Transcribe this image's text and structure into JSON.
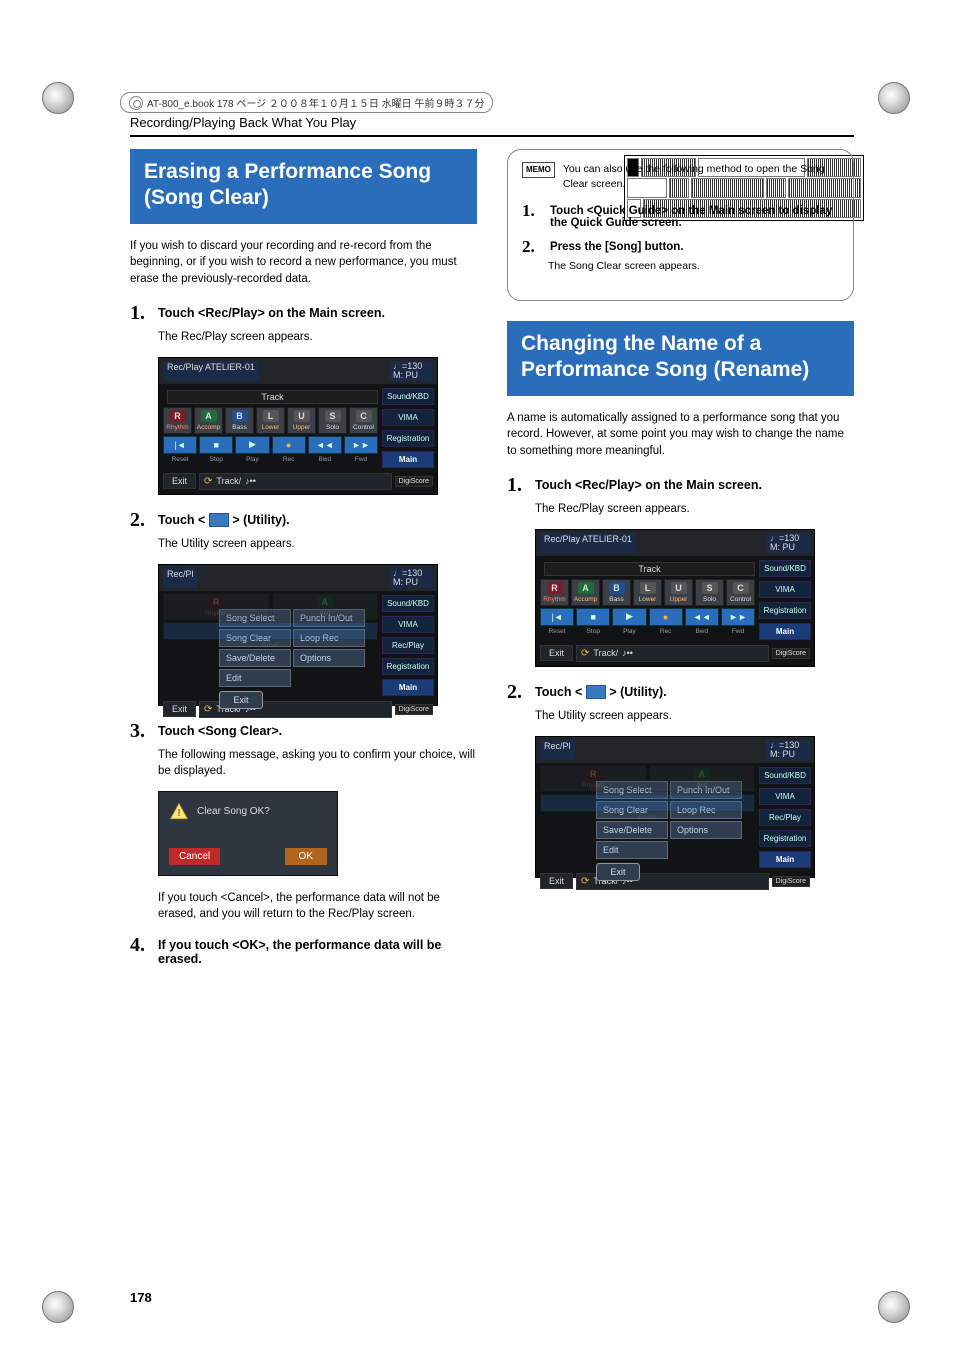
{
  "meta": {
    "header_line": "AT-800_e.book 178 ページ ２００８年１０月１５日 水曜日 午前９時３７分"
  },
  "section_header": "Recording/Playing Back What You Play",
  "left": {
    "heading": "Erasing a Performance Song (Song Clear)",
    "intro": "If you wish to discard your recording and re-record from the beginning, or if you wish to record a new performance, you must erase the previously-recorded data.",
    "step1_title": "Touch <Rec/Play> on the Main screen.",
    "step1_body": "The Rec/Play screen appears.",
    "step2_title_a": "Touch <",
    "step2_title_b": "> (Utility).",
    "step2_body": "The Utility screen appears.",
    "step3_title": "Touch <Song Clear>.",
    "step3_body": "The following message, asking you to confirm your choice, will be displayed.",
    "confirm_text": "Clear Song OK?",
    "cancel": "Cancel",
    "ok": "OK",
    "after_confirm": "If you touch <Cancel>, the performance data will not be erased, and you will return to the Rec/Play screen.",
    "step4_title": "If you touch <OK>, the performance data will be erased."
  },
  "right": {
    "memo_label": "MEMO",
    "memo_text": "You can also use the following method to open the Song Clear screen.",
    "memo_step1": "Touch <Quick Guide> on the Main screen to display the Quick Guide screen.",
    "memo_step2_title": "Press the [Song] button.",
    "memo_step2_body": "The Song Clear screen appears.",
    "heading": "Changing the Name of a Performance Song (Rename)",
    "intro": "A name is automatically assigned to a performance song that you record. However, at some point you may wish to change the name to something more meaningful.",
    "step1_title": "Touch <Rec/Play> on the Main screen.",
    "step1_body": "The Rec/Play screen appears.",
    "step2_title_a": "Touch <",
    "step2_title_b": "> (Utility).",
    "step2_body": "The Utility screen appears."
  },
  "shot": {
    "hdr_left": "Rec/Play    ATELIER-01",
    "hdr_right": "♩=130\nM: PU",
    "track": "Track",
    "tracks": [
      {
        "k": "R",
        "l": "Rhythm",
        "c": "red",
        "lcol": "red"
      },
      {
        "k": "A",
        "l": "Accomp",
        "c": "grn",
        "lcol": "orange"
      },
      {
        "k": "B",
        "l": "Bass",
        "c": "blu",
        "lcol": ""
      },
      {
        "k": "L",
        "l": "Lower",
        "c": "gry",
        "lcol": "orange"
      },
      {
        "k": "U",
        "l": "Upper",
        "c": "gry",
        "lcol": "orange"
      },
      {
        "k": "S",
        "l": "Solo",
        "c": "gry",
        "lcol": ""
      },
      {
        "k": "C",
        "l": "Control",
        "c": "gry",
        "lcol": ""
      }
    ],
    "transport": [
      "Reset",
      "Stop",
      "Play",
      "Rec",
      "Bwd",
      "Fwd"
    ],
    "side": [
      "Sound/KBD",
      "VIMA",
      "Registration",
      "Main"
    ],
    "side_rec": "Rec/Play",
    "exit": "Exit",
    "track_pill": "Track/",
    "digi": "DigiScore"
  },
  "util": {
    "opts": [
      [
        "Song Select",
        "Punch In/Out"
      ],
      [
        "Song Clear",
        "Loop Rec"
      ],
      [
        "Save/Delete",
        "Options"
      ],
      [
        "Edit",
        ""
      ]
    ],
    "exit": "Exit"
  },
  "page_number": "178"
}
